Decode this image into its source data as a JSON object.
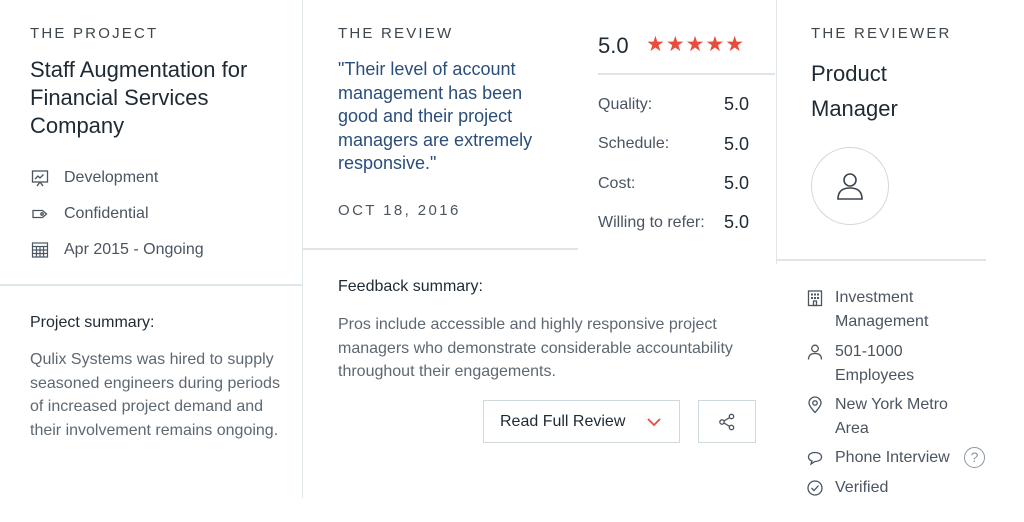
{
  "project": {
    "section_label": "THE PROJECT",
    "title": "Staff Augmentation for Financial Services Company",
    "service": "Development",
    "budget": "Confidential",
    "dates": "Apr 2015 - Ongoing",
    "summary_heading": "Project summary:",
    "summary_text": "Qulix Systems was hired to supply seasoned engineers during periods of increased project demand and their involvement remains ongoing."
  },
  "review": {
    "section_label": "THE REVIEW",
    "quote": "\"Their level of account management has been good and their project managers are extremely responsive.\"",
    "date": "OCT 18, 2016",
    "overall_score": "5.0",
    "stars": "★★★★★",
    "ratings": [
      {
        "label": "Quality:",
        "value": "5.0"
      },
      {
        "label": "Schedule:",
        "value": "5.0"
      },
      {
        "label": "Cost:",
        "value": "5.0"
      },
      {
        "label": "Willing to refer:",
        "value": "5.0"
      }
    ],
    "feedback_heading": "Feedback summary:",
    "feedback_text": "Pros include accessible and highly responsive project managers who demonstrate considerable accountability throughout their engagements.",
    "read_full_label": "Read Full Review",
    "star_color": "#e74c3c",
    "quote_color": "#2a4e7b"
  },
  "reviewer": {
    "section_label": "THE REVIEWER",
    "title": "Product Manager",
    "industry": "Investment Management",
    "company_size": "501-1000 Employees",
    "location": "New York Metro Area",
    "interview_type": "Phone Interview",
    "help_symbol": "?",
    "status": "Verified"
  },
  "icons": [
    "presentation-icon",
    "tag-icon",
    "calendar-icon",
    "chevron-down-icon",
    "share-icon",
    "user-icon",
    "building-icon",
    "person-icon",
    "location-pin-icon",
    "chat-bubble-icon",
    "help-icon",
    "check-circle-icon"
  ]
}
